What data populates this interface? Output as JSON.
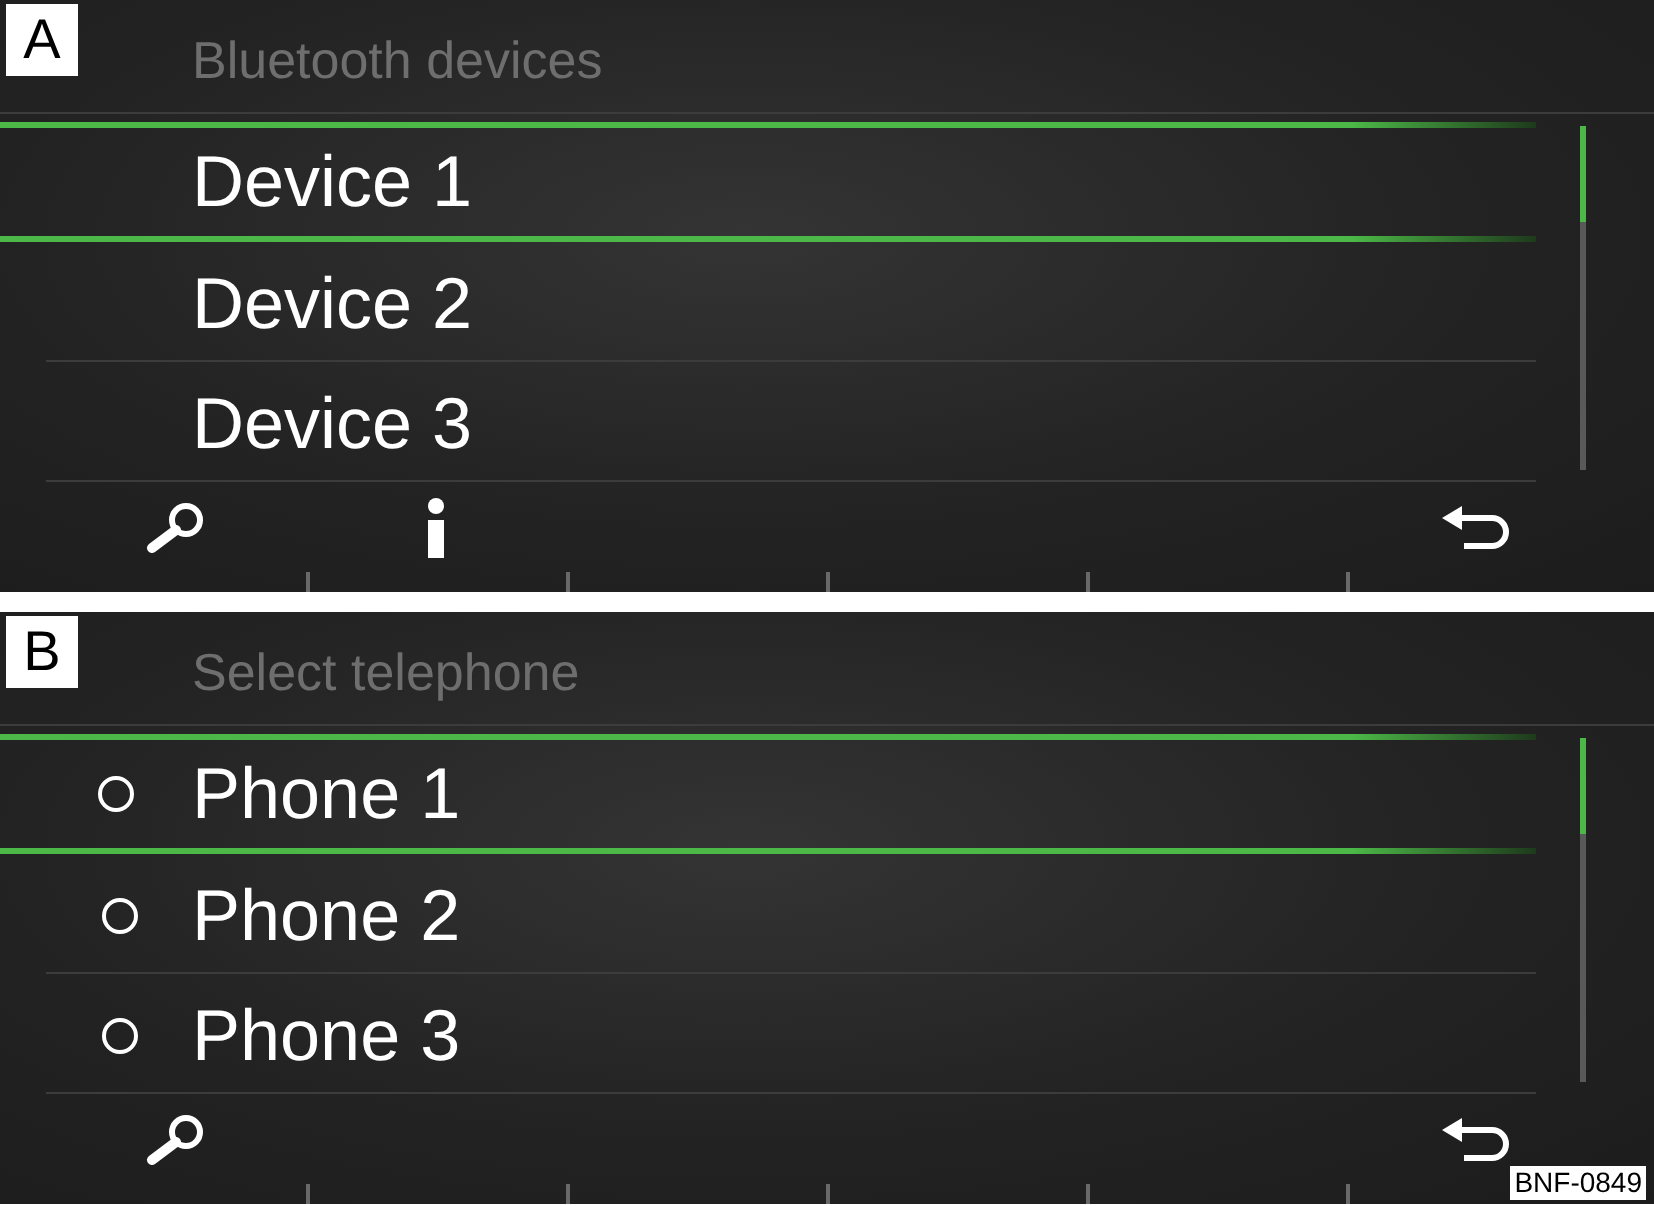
{
  "panels": [
    {
      "label": "A",
      "title": "Bluetooth devices",
      "items": [
        {
          "kind": "plain",
          "text": "Device 1",
          "selected": true
        },
        {
          "kind": "plain",
          "text": "Device 2",
          "selected": false
        },
        {
          "kind": "plain",
          "text": "Device 3",
          "selected": false
        }
      ],
      "buttons": [
        {
          "kind": "search"
        },
        {
          "kind": "info"
        },
        {
          "kind": "back"
        }
      ]
    },
    {
      "label": "B",
      "title": "Select telephone",
      "items": [
        {
          "kind": "radio",
          "text": "Phone 1",
          "selected": true,
          "checked": false
        },
        {
          "kind": "radio",
          "text": "Phone 2",
          "selected": false,
          "checked": false
        },
        {
          "kind": "radio",
          "text": "Phone 3",
          "selected": false,
          "checked": false
        }
      ],
      "buttons": [
        {
          "kind": "search"
        },
        {
          "kind": "back"
        }
      ]
    }
  ],
  "figure_code": "BNF-0849"
}
